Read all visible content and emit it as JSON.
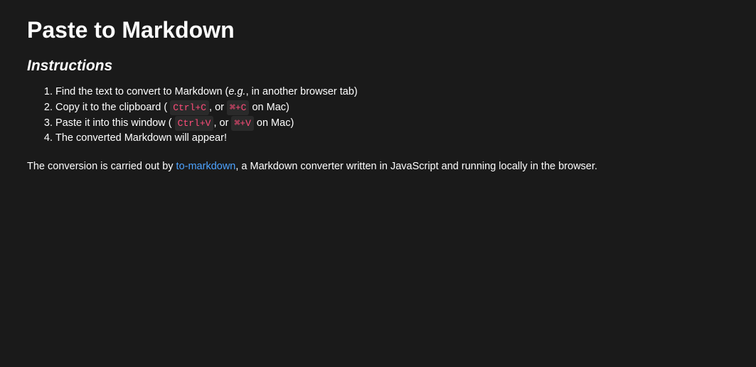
{
  "title": "Paste to Markdown",
  "instructions_heading": "Instructions",
  "steps": {
    "s1_a": "Find the text to convert to Markdown (",
    "s1_b": "e.g.",
    "s1_c": ", in another browser tab)",
    "s2_a": "Copy it to the clipboard (",
    "s2_kbd1": "Ctrl+C",
    "s2_b": ", or",
    "s2_kbd2": "⌘+C",
    "s2_c": " on Mac)",
    "s3_a": "Paste it into this window (",
    "s3_kbd1": "Ctrl+V",
    "s3_b": ", or",
    "s3_kbd2": "⌘+V",
    "s3_c": " on Mac)",
    "s4": "The converted Markdown will appear!"
  },
  "footer": {
    "a": "The conversion is carried out by ",
    "link": "to-markdown",
    "b": ", a Markdown converter written in JavaScript and running locally in the browser."
  }
}
